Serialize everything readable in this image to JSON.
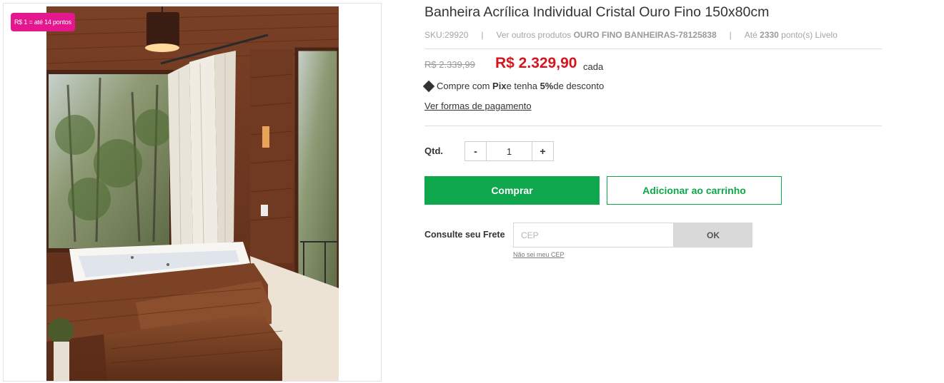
{
  "product": {
    "title": "Banheira Acrílica Individual Cristal Ouro Fino 150x80cm",
    "image_alt": "Banheira de hidromassagem em ambiente de madeira com cortinas e janela para a mata",
    "points_badge": "R$ 1 = até 14 pontos"
  },
  "meta": {
    "sku": "SKU:29920",
    "separator": "|",
    "other_products_prefix": "Ver outros produtos ",
    "brand": "OURO FINO BANHEIRAS-78125838",
    "points_prefix": "Até ",
    "points_value": "2330",
    "points_suffix": " ponto(s) Livelo"
  },
  "price": {
    "old": "R$ 2.339,99",
    "current": "R$ 2.329,90",
    "unit": "cada"
  },
  "pix": {
    "prefix": "Compre com ",
    "method": "Pix",
    "middle": " e tenha ",
    "discount": "5%",
    "suffix": " de desconto"
  },
  "payment_link": "Ver formas de pagamento",
  "quantity": {
    "label": "Qtd.",
    "minus": "-",
    "value": "1",
    "plus": "+"
  },
  "actions": {
    "buy": "Comprar",
    "add_to_cart": "Adicionar ao carrinho"
  },
  "shipping": {
    "label": "Consulte seu Frete",
    "placeholder": "CEP",
    "ok": "OK",
    "unknown_cep": "Não sei meu CEP"
  },
  "colors": {
    "accent_green": "#0fa74b",
    "price_red": "#d7141e",
    "badge_pink": "#e4178f"
  }
}
